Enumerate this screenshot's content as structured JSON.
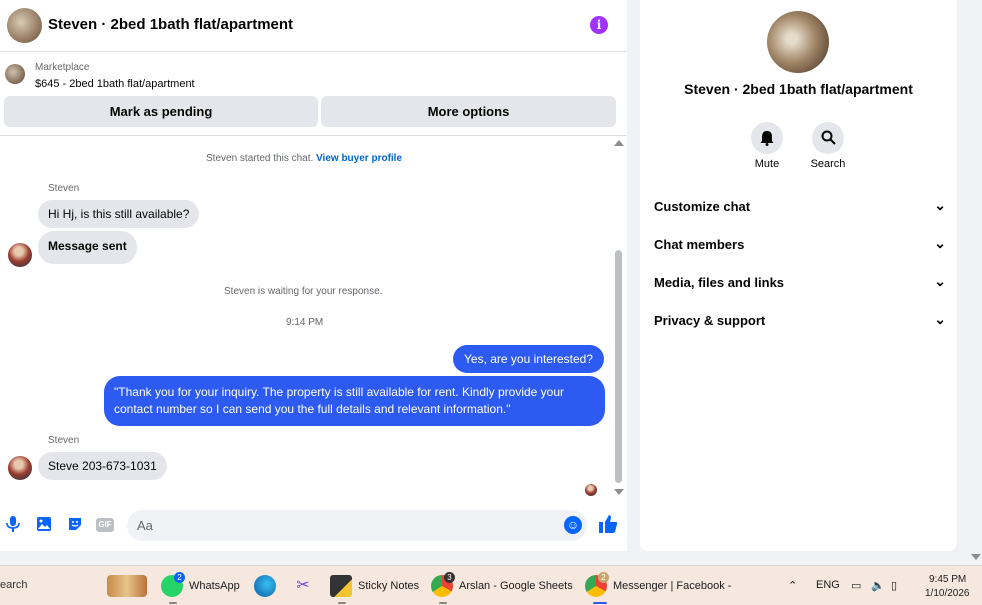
{
  "chat": {
    "title": "Steven · 2bed 1bath flat/apartment",
    "marketplace_label": "Marketplace",
    "listing": "$645 - 2bed 1bath flat/apartment",
    "mark_pending_label": "Mark as pending",
    "more_options_label": "More options",
    "started_text": "Steven started this chat.",
    "view_profile_label": "View buyer profile",
    "waiting_text": "Steven is waiting for your response.",
    "timestamp": "9:14 PM",
    "messages": [
      {
        "sender": "Steven",
        "text": "Hi Hj, is this still available?"
      },
      {
        "sender": "Steven",
        "text": "Message sent"
      },
      {
        "sender": "me",
        "text": "Yes, are you interested?"
      },
      {
        "sender": "me",
        "text": "\"Thank you for your inquiry. The property is still available for rent. Kindly provide your contact number so I can send you the full details and relevant information.\""
      },
      {
        "sender": "Steven",
        "text": "Steve 203-673-1031"
      }
    ],
    "sender_name": "Steven",
    "composer_placeholder": "Aa",
    "gif_label": "GIF"
  },
  "info_panel": {
    "title": "Steven · 2bed 1bath flat/apartment",
    "mute_label": "Mute",
    "search_label": "Search",
    "sections": [
      "Customize chat",
      "Chat members",
      "Media, files and links",
      "Privacy & support"
    ]
  },
  "taskbar": {
    "search_text": "earch",
    "apps": [
      {
        "label": "WhatsApp",
        "badge": "2"
      },
      {
        "label": "Sticky Notes"
      },
      {
        "label": "Arslan - Google Sheets",
        "badge": "3"
      },
      {
        "label": "Messenger | Facebook -",
        "badge": "2"
      }
    ],
    "language": "ENG",
    "time": "9:45 PM",
    "date": "1/10/2026"
  },
  "colors": {
    "accent": "#0866ff",
    "outgoing_bubble": "#2d5af0",
    "info_icon": "#a033ff"
  }
}
